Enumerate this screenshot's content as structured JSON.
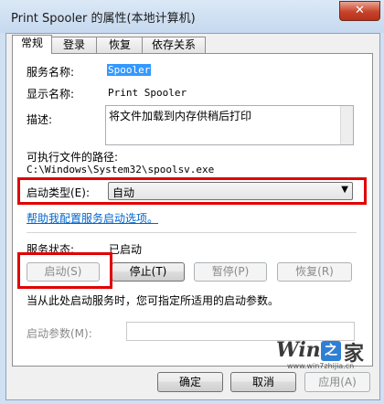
{
  "window": {
    "title": "Print Spooler 的属性(本地计算机)",
    "close_glyph": "✕"
  },
  "tabs": [
    {
      "label": "常规"
    },
    {
      "label": "登录"
    },
    {
      "label": "恢复"
    },
    {
      "label": "依存关系"
    }
  ],
  "general": {
    "service_name_label": "服务名称:",
    "service_name_value": "Spooler",
    "display_name_label": "显示名称:",
    "display_name_value": "Print Spooler",
    "description_label": "描述:",
    "description_value": "将文件加载到内存供稍后打印",
    "exe_path_label": "可执行文件的路径:",
    "exe_path_value": "C:\\Windows\\System32\\spoolsv.exe",
    "startup_type_label": "启动类型(E):",
    "startup_type_value": "自动",
    "help_link": "帮助我配置服务启动选项。",
    "status_label": "服务状态:",
    "status_value": "已启动",
    "start_button": "启动(S)",
    "stop_button": "停止(T)",
    "pause_button": "暂停(P)",
    "resume_button": "恢复(R)",
    "hint_text": "当从此处启动服务时，您可指定所适用的启动参数。",
    "params_label": "启动参数(M):",
    "params_value": ""
  },
  "footer": {
    "ok_button": "确定",
    "cancel_button": "取消",
    "apply_button": "应用(A)"
  },
  "watermark": {
    "brand": "Win7",
    "box_char": "之",
    "suffix": "家",
    "url": "www.win7zhijia.cn"
  },
  "colors": {
    "highlight_outline": "#e00000",
    "selection": "#3399ff",
    "link": "#0066cc"
  }
}
